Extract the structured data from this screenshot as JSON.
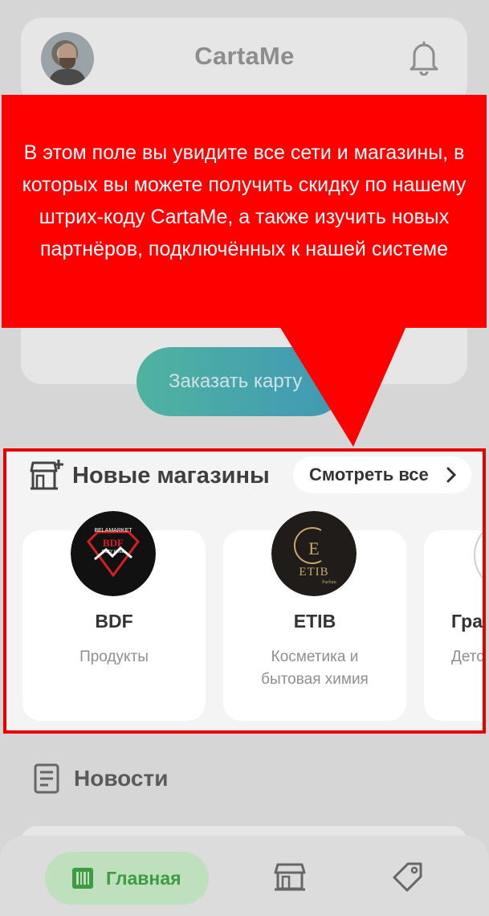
{
  "header": {
    "title": "CartaMe"
  },
  "promo": {
    "order_button": "Заказать карту"
  },
  "new_stores": {
    "title": "Новые магазины",
    "see_all": "Смотреть все",
    "stores": [
      {
        "name": "BDF",
        "category": "Продукты"
      },
      {
        "name": "ETIB",
        "category": "Косметика и бытовая химия"
      },
      {
        "name": "Град",
        "category": "Детс"
      }
    ],
    "logos": {
      "bdf_text": "BDF",
      "bdf_top": "BELAMARKET",
      "bdf_bottom": "DUTY FREE",
      "etib_letter": "E",
      "etib_text": "ETIB",
      "etib_sub": "Parfum"
    }
  },
  "news": {
    "title": "Новости"
  },
  "bottom_nav": {
    "home_label": "Главная"
  },
  "tooltip": {
    "text": "В этом поле вы увидите все сети и магазины, в которых вы можете получить скидку по нашему штрих-коду CartaMe, а также изучить новых партнёров, подключённых к нашей системе"
  },
  "colors": {
    "highlight_border": "#e60000",
    "tooltip_bg": "#ff0000",
    "home_accent": "#3f9b43"
  }
}
